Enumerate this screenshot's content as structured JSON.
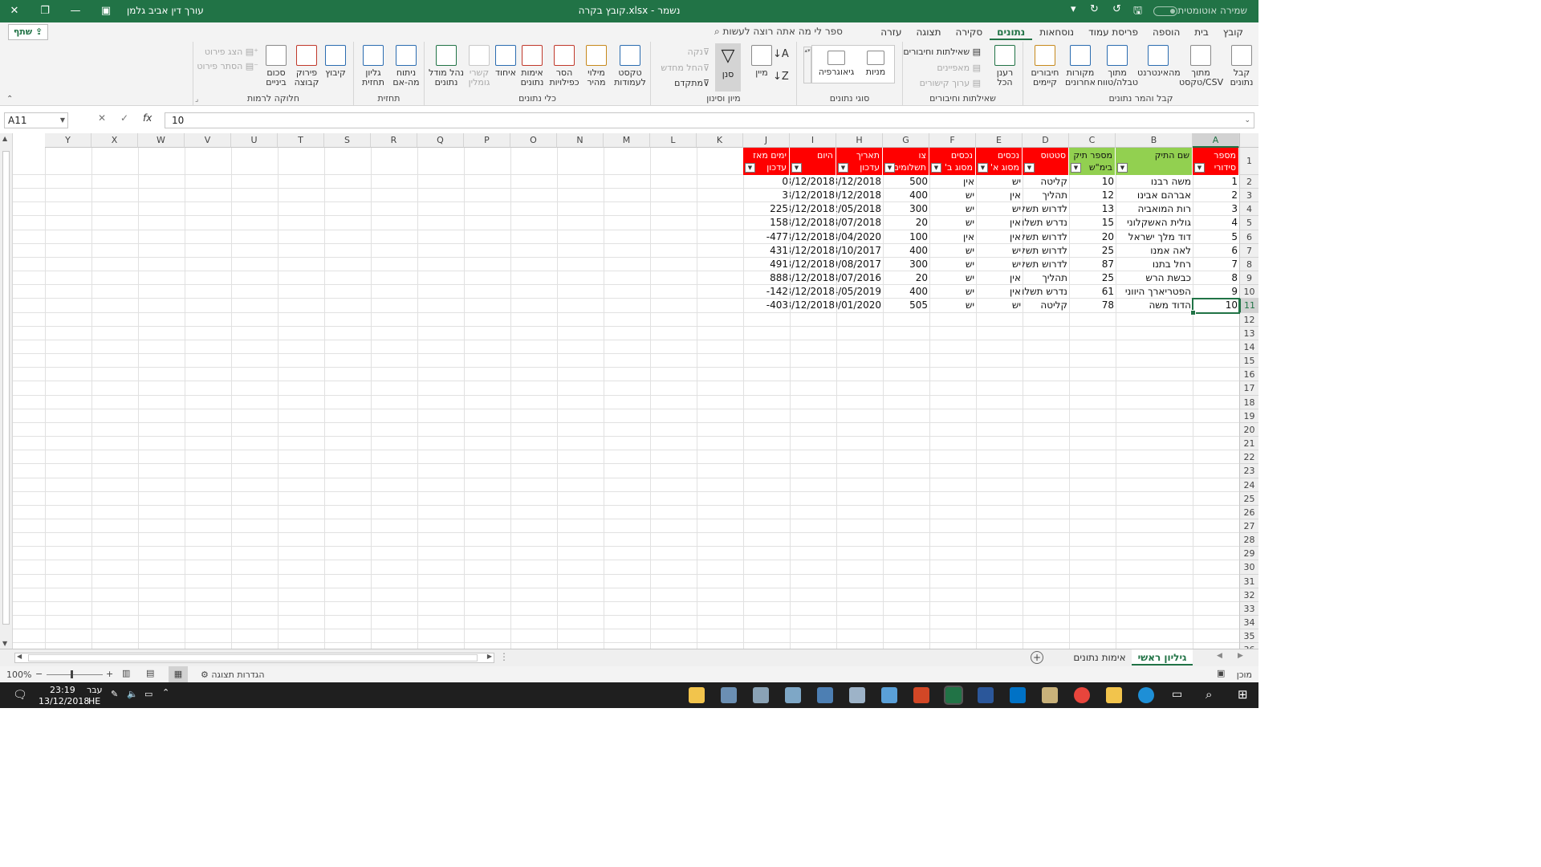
{
  "window": {
    "title": "קובץ בקרה.xlsx  -  נשמר",
    "user": "עורך דין אביב גלמן",
    "autosave": "שמירה אוטומטית"
  },
  "menu": {
    "tabs": [
      "קובץ",
      "בית",
      "הוספה",
      "פריסת עמוד",
      "נוסחאות",
      "נתונים",
      "סקירה",
      "תצוגה",
      "עזרה"
    ],
    "active_index": 5,
    "tell_me": "ספר לי מה אתה רוצה לעשות",
    "share": "שתף"
  },
  "ribbon": {
    "get_data": {
      "label": "קבל והמר נתונים",
      "buttons": [
        "קבל נתונים",
        "מתוך טקסט/CSV",
        "מהאינטרנט",
        "מתוך טבלה/טווח",
        "מקורות אחרונים",
        "חיבורים קיימים"
      ]
    },
    "queries": {
      "label": "שאילתות וחיבורים",
      "refresh": "רענן הכל",
      "items": [
        "שאילתות וחיבורים",
        "מאפיינים",
        "ערוך קישורים"
      ]
    },
    "data_types": {
      "label": "סוגי נתונים",
      "stocks": "מניות",
      "geo": "גיאוגרפיה"
    },
    "sort_filter": {
      "label": "מיון וסינון",
      "sort": "מיין",
      "filter": "סנן",
      "clear": "נקה",
      "reapply": "החל מחדש",
      "advanced": "מתקדם"
    },
    "data_tools": {
      "label": "כלי נתונים",
      "buttons": [
        "טקסט לעמודות",
        "מילוי מהיר",
        "הסר כפילויות",
        "אימות נתונים",
        "איחוד",
        "קשרי גומלין",
        "נהל מודל נתונים"
      ]
    },
    "forecast": {
      "label": "תחזית",
      "buttons": [
        "ניתוח מה-אם",
        "גליון תחזית"
      ]
    },
    "outline": {
      "label": "חלוקה לרמות",
      "buttons": [
        "קיבוץ",
        "פירוק קבוצה",
        "סכום ביניים"
      ],
      "show": "הצג פירוט",
      "hide": "הסתר פירוט"
    }
  },
  "formula_bar": {
    "name_box": "A11",
    "value": "10"
  },
  "columns": [
    "A",
    "B",
    "C",
    "D",
    "E",
    "F",
    "G",
    "H",
    "I",
    "J",
    "K",
    "L",
    "M",
    "N",
    "O",
    "P",
    "Q",
    "R",
    "S",
    "T",
    "U",
    "V",
    "W",
    "X",
    "Y"
  ],
  "rows": [
    "1",
    "2",
    "3",
    "4",
    "5",
    "6",
    "7",
    "8",
    "9",
    "10",
    "11",
    "12",
    "13",
    "14",
    "15",
    "16",
    "17",
    "18",
    "19",
    "20",
    "21",
    "22",
    "23",
    "24",
    "25",
    "26",
    "27",
    "28",
    "29",
    "30",
    "31",
    "32",
    "33",
    "34",
    "35",
    "36",
    "37"
  ],
  "table": {
    "headers": [
      {
        "col": "A",
        "lines": [
          "מספר",
          "סידורי"
        ],
        "color": "red"
      },
      {
        "col": "B",
        "lines": [
          "שם התיק",
          ""
        ],
        "color": "green"
      },
      {
        "col": "C",
        "lines": [
          "מספר תיק",
          "בימ\"ש"
        ],
        "color": "green"
      },
      {
        "col": "D",
        "lines": [
          "סטטוס",
          ""
        ],
        "color": "red"
      },
      {
        "col": "E",
        "lines": [
          "נכסים",
          "מסוג א'"
        ],
        "color": "red"
      },
      {
        "col": "F",
        "lines": [
          "נכסים",
          "מסוג ב'"
        ],
        "color": "red"
      },
      {
        "col": "G",
        "lines": [
          "צו",
          "תשלומים"
        ],
        "color": "red"
      },
      {
        "col": "H",
        "lines": [
          "תאריך",
          "עדכון"
        ],
        "color": "red"
      },
      {
        "col": "I",
        "lines": [
          "היום",
          ""
        ],
        "color": "red"
      },
      {
        "col": "J",
        "lines": [
          "ימים מאז",
          "עדכון"
        ],
        "color": "red"
      }
    ],
    "rows": [
      [
        "1",
        "משה רבנו",
        "10",
        "קליטה",
        "יש",
        "אין",
        "500",
        "13/12/2018",
        "13/12/2018",
        "0"
      ],
      [
        "2",
        "אברהם אבינו",
        "12",
        "תהליך",
        "אין",
        "יש",
        "400",
        "10/12/2018",
        "13/12/2018",
        "3"
      ],
      [
        "3",
        "רות המואביה",
        "13",
        "לדרוש תשל",
        "יש",
        "יש",
        "300",
        "02/05/2018",
        "13/12/2018",
        "225"
      ],
      [
        "4",
        "גולית האשקלוני",
        "15",
        "נדרש תשלו",
        "אין",
        "יש",
        "20",
        "08/07/2018",
        "13/12/2018",
        "158"
      ],
      [
        "5",
        "דוד מלך ישראל",
        "20",
        "לדרוש תשל",
        "אין",
        "אין",
        "100",
        "03/04/2020",
        "13/12/2018",
        "-477"
      ],
      [
        "6",
        "לאה אמנו",
        "25",
        "לדרוש תשל",
        "יש",
        "יש",
        "400",
        "08/10/2017",
        "13/12/2018",
        "431"
      ],
      [
        "7",
        "רחל בתנו",
        "87",
        "לדרוש תשל",
        "יש",
        "יש",
        "300",
        "09/08/2017",
        "13/12/2018",
        "491"
      ],
      [
        "8",
        "כבשת הרש",
        "25",
        "תהליך",
        "אין",
        "יש",
        "20",
        "08/07/2016",
        "13/12/2018",
        "888"
      ],
      [
        "9",
        "הפטריארך היווני",
        "61",
        "נדרש תשלו",
        "אין",
        "יש",
        "400",
        "04/05/2019",
        "13/12/2018",
        "-142"
      ],
      [
        "10",
        "הדוד משה",
        "78",
        "קליטה",
        "יש",
        "יש",
        "505",
        "20/01/2020",
        "13/12/2018",
        "-403"
      ]
    ]
  },
  "sheets": {
    "tabs": [
      "גיליון ראשי",
      "אימות נתונים"
    ],
    "active_index": 0
  },
  "status": {
    "ready": "מוכן",
    "zoom": "100%",
    "display": "הגדרות תצוגה"
  },
  "taskbar": {
    "time": "23:19",
    "date": "13/12/2018",
    "lang": "עבר",
    "lang2": "HE"
  },
  "colors": {
    "excel_green": "#217346",
    "header_red": "#ff0000",
    "header_green": "#92d050"
  }
}
